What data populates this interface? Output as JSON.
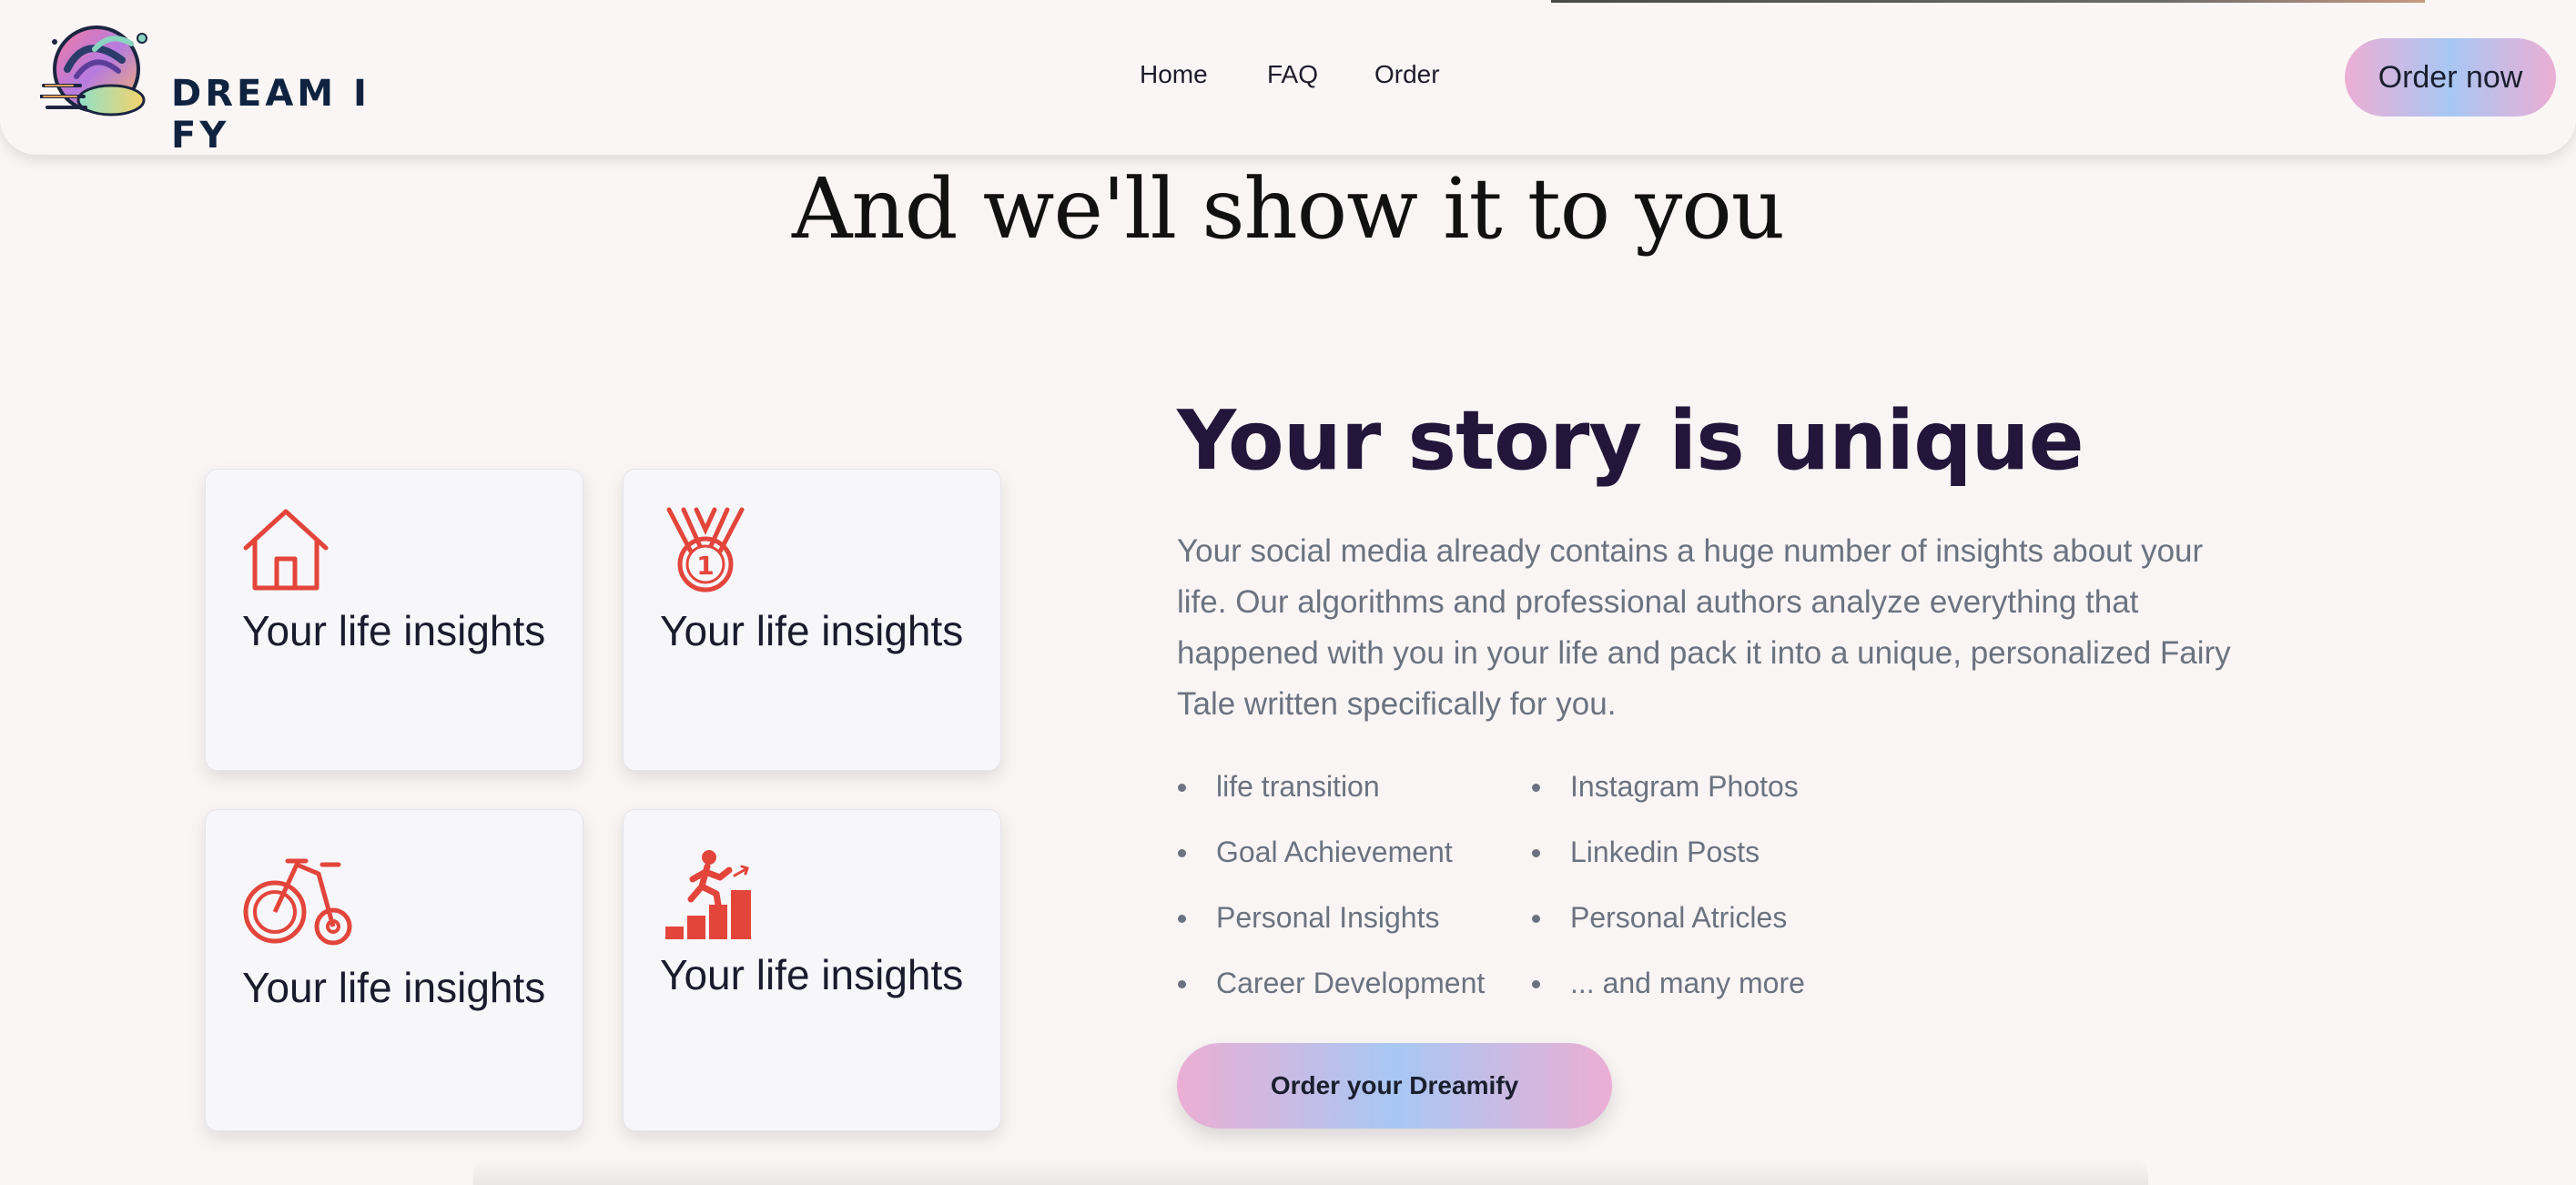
{
  "header": {
    "logo_text": "DREAM I FY",
    "nav": {
      "home": "Home",
      "faq": "FAQ",
      "order": "Order"
    },
    "cta_label": "Order now"
  },
  "hero": {
    "title": "And we'll show it to you"
  },
  "cards": [
    {
      "icon": "house-icon",
      "label": "Your life insights"
    },
    {
      "icon": "medal-icon",
      "label": "Your life insights"
    },
    {
      "icon": "bicycle-icon",
      "label": "Your life insights"
    },
    {
      "icon": "stairs-climb-icon",
      "label": "Your life insights"
    }
  ],
  "story": {
    "title": "Your story is unique",
    "description": "Your social media already contains a huge number of insights about your life. Our algorithms and professional authors analyze everything that happened with you in your life and pack it into a unique, personalized Fairy Tale written specifically for you.",
    "list_left": [
      "life transition",
      "Goal Achievement",
      "Personal Insights",
      "Career Development"
    ],
    "list_right": [
      "Instagram Photos",
      "Linkedin Posts",
      "Personal Atricles",
      "... and many more"
    ],
    "button_label": "Order your Dreamify"
  },
  "colors": {
    "accent_red": "#e3453b",
    "title_dark": "#23163a",
    "text_gray": "#6b7280",
    "button_gradient": [
      "#ecaed4",
      "#a7c7f3"
    ]
  }
}
